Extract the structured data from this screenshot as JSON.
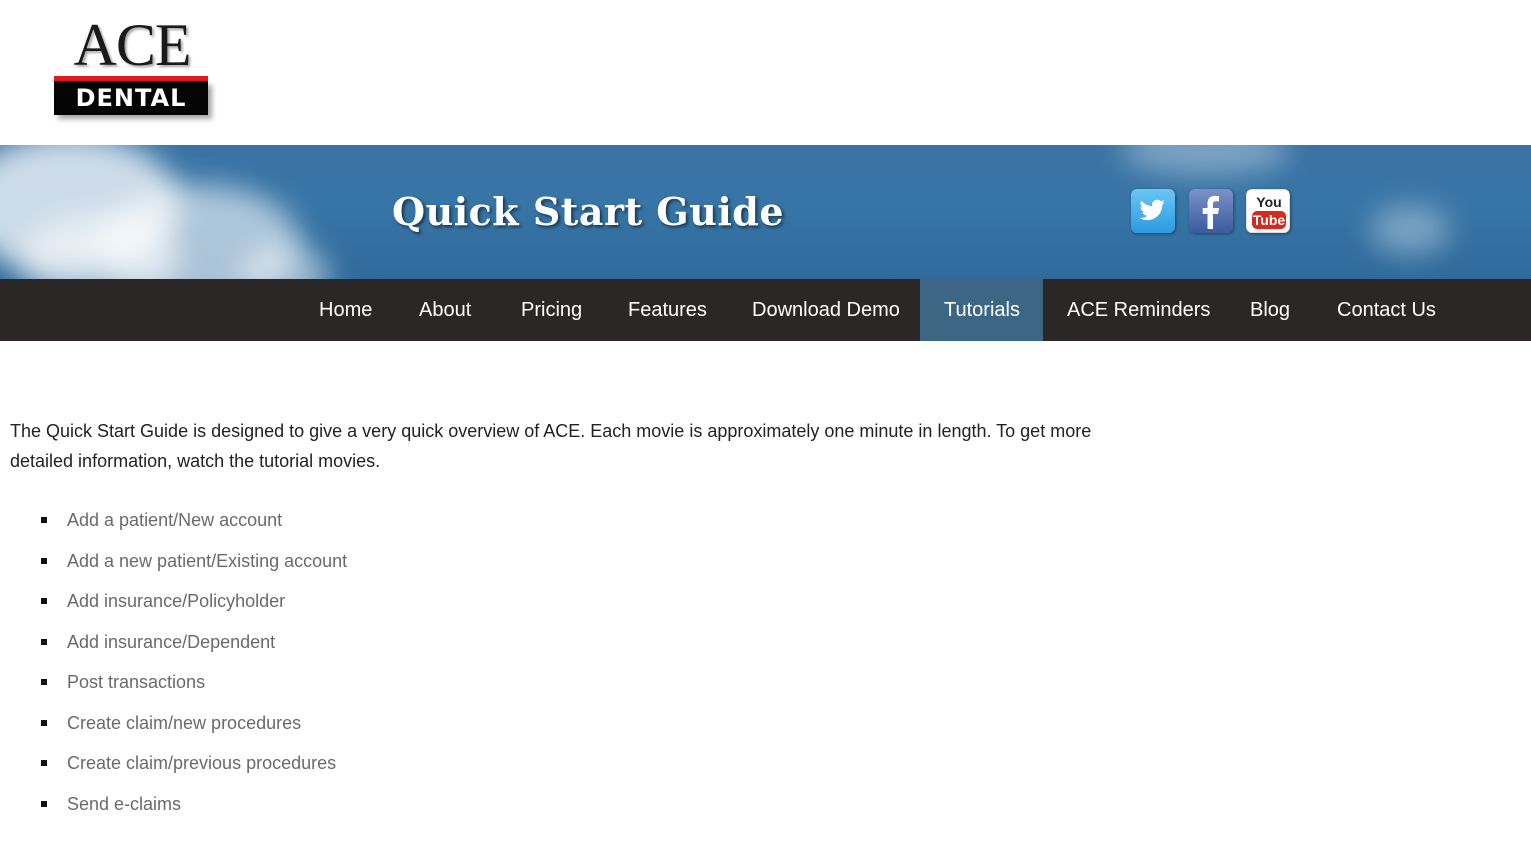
{
  "logo": {
    "line1": "ACE",
    "line2": "DENTAL"
  },
  "banner": {
    "title": "Quick Start Guide",
    "social": [
      {
        "name": "Twitter",
        "icon": "twitter-icon",
        "color": "#2a9be0"
      },
      {
        "name": "Facebook",
        "icon": "facebook-icon",
        "color": "#3b5b9f"
      },
      {
        "name": "YouTube",
        "icon": "youtube-icon",
        "color": "#d52b1e",
        "text_top": "You",
        "text_bottom": "Tube"
      }
    ]
  },
  "nav": {
    "items": [
      {
        "label": "Home"
      },
      {
        "label": "About"
      },
      {
        "label": "Pricing"
      },
      {
        "label": "Features"
      },
      {
        "label": "Download Demo"
      },
      {
        "label": "Tutorials",
        "active": true
      },
      {
        "label": "ACE Reminders"
      },
      {
        "label": "Blog"
      },
      {
        "label": "Contact Us"
      }
    ]
  },
  "content": {
    "intro": "The Quick Start Guide is designed to give a very quick overview of ACE. Each movie is approximately one minute in length. To get more detailed information, watch the tutorial movies.",
    "items": [
      "Add a patient/New account",
      "Add a new patient/Existing account",
      "Add insurance/Policyholder",
      "Add insurance/Dependent",
      "Post transactions",
      "Create claim/new procedures",
      "Create claim/previous procedures",
      "Send e-claims"
    ]
  },
  "colors": {
    "nav_background": "#2a2726",
    "nav_active": "#3d6684",
    "banner_blue": "#3775a6",
    "link_gray": "#6a6a6a",
    "logo_red": "#e01b1b"
  }
}
